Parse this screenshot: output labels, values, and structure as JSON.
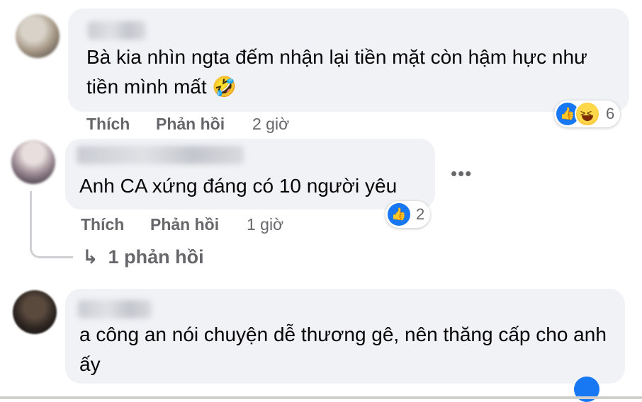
{
  "comments": [
    {
      "text": "Bà kia nhìn ngta đếm nhận lại tiền mặt còn hậm hực như tiền mình mất 🤣",
      "like_label": "Thích",
      "reply_label": "Phản hồi",
      "time": "2 giờ",
      "reaction_count": "6",
      "reactions": [
        "like-icon",
        "haha-icon"
      ]
    },
    {
      "text": "Anh CA xứng đáng có 10 người yêu",
      "like_label": "Thích",
      "reply_label": "Phản hồi",
      "time": "1 giờ",
      "reaction_count": "2",
      "reactions": [
        "like-icon"
      ],
      "more_label": "•••",
      "replies_arrow": "↳",
      "replies_label": "1 phản hồi"
    },
    {
      "text": "a công an nói chuyện dễ thương gê, nên thăng cấp cho anh ấy"
    }
  ],
  "colors": {
    "bubble": "#f0f2f5",
    "muted": "#65676b",
    "like_blue": "#1877f2"
  }
}
